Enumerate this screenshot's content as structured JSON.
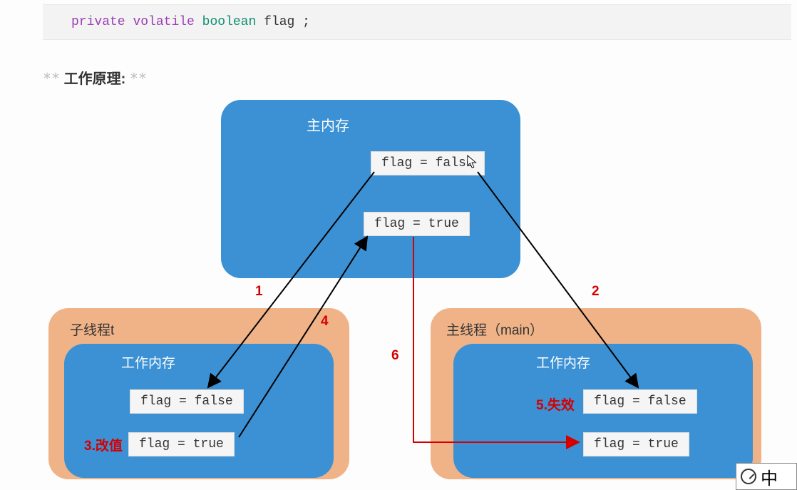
{
  "code": {
    "private": "private",
    "volatile": "volatile",
    "boolean": "boolean",
    "var": "flag",
    "semi": ";"
  },
  "heading": {
    "stars_left": "**",
    "title": "工作原理:",
    "stars_right": "**"
  },
  "main_memory": {
    "label": "主内存",
    "value1": "flag = false",
    "value2": "flag = true"
  },
  "child_thread": {
    "outer_label": "子线程t",
    "inner_label": "工作内存",
    "value1": "flag = false",
    "value2": "flag = true"
  },
  "main_thread": {
    "outer_label": "主线程（main）",
    "inner_label": "工作内存",
    "value1": "flag = false",
    "value2": "flag = true"
  },
  "annotations": {
    "n1": "1",
    "n2": "2",
    "n3": "3.改值",
    "n4": "4",
    "n5": "5.失效",
    "n6": "6"
  },
  "ime": {
    "char": "中"
  }
}
